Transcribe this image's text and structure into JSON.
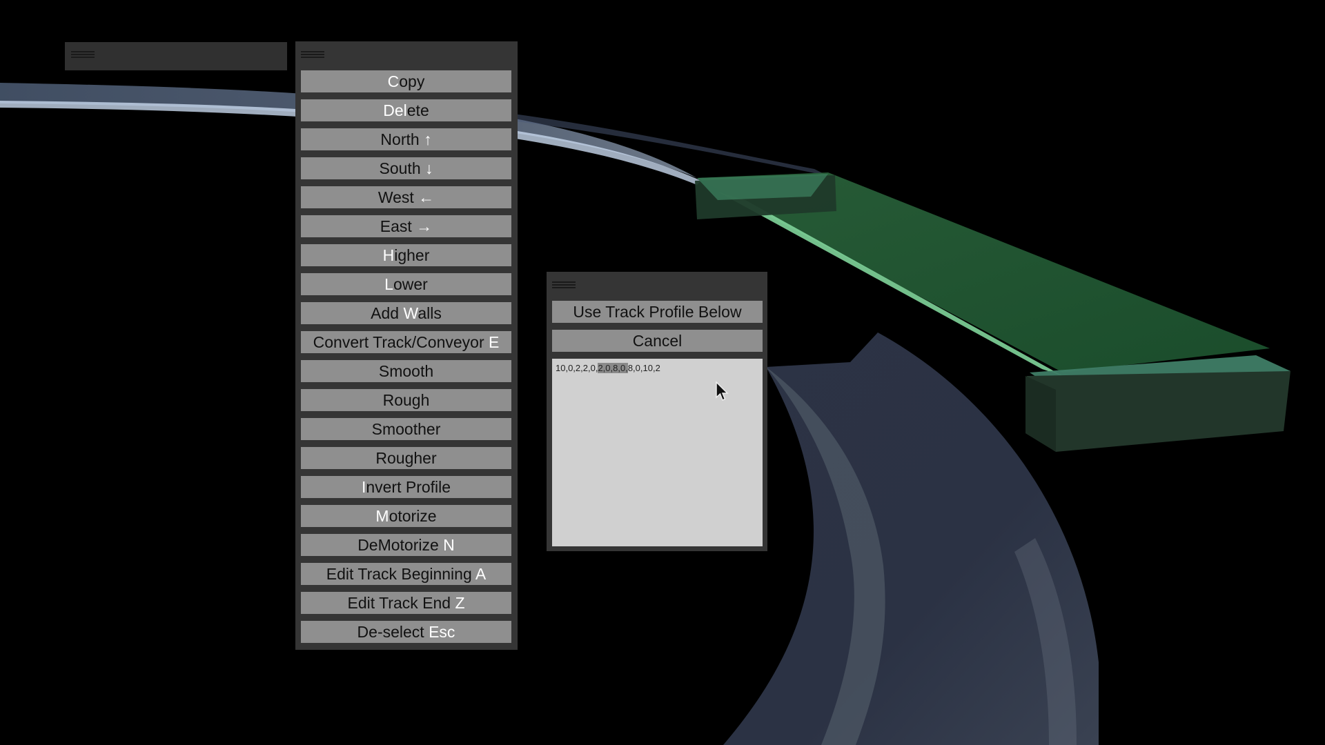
{
  "menu": {
    "items": [
      {
        "id": "copy",
        "pre": "",
        "hk": "C",
        "post": "opy"
      },
      {
        "id": "delete",
        "pre": "",
        "hk": "Del",
        "post": "ete"
      },
      {
        "id": "north",
        "pre": "North ",
        "hk": "↑",
        "post": ""
      },
      {
        "id": "south",
        "pre": "South ",
        "hk": "↓",
        "post": ""
      },
      {
        "id": "west",
        "pre": "West ",
        "hk": "←",
        "post": ""
      },
      {
        "id": "east",
        "pre": "East ",
        "hk": "→",
        "post": ""
      },
      {
        "id": "higher",
        "pre": "",
        "hk": "H",
        "post": "igher"
      },
      {
        "id": "lower",
        "pre": "",
        "hk": "L",
        "post": "ower"
      },
      {
        "id": "add-walls",
        "pre": "Add ",
        "hk": "W",
        "post": "alls"
      },
      {
        "id": "convert-track-conveyor",
        "pre": "Convert Track/Conveyor ",
        "hk": "E",
        "post": ""
      },
      {
        "id": "smooth",
        "pre": "Smooth",
        "hk": "",
        "post": ""
      },
      {
        "id": "rough",
        "pre": "Rough",
        "hk": "",
        "post": ""
      },
      {
        "id": "smoother",
        "pre": "Smoother",
        "hk": "",
        "post": ""
      },
      {
        "id": "rougher",
        "pre": "Rougher",
        "hk": "",
        "post": ""
      },
      {
        "id": "invert-profile",
        "pre": "",
        "hk": "I",
        "post": "nvert Profile"
      },
      {
        "id": "motorize",
        "pre": "",
        "hk": "M",
        "post": "otorize"
      },
      {
        "id": "demotorize",
        "pre": "DeMotorize ",
        "hk": "N",
        "post": ""
      },
      {
        "id": "edit-track-beginning",
        "pre": "Edit Track Beginning ",
        "hk": "A",
        "post": ""
      },
      {
        "id": "edit-track-end",
        "pre": "Edit Track End ",
        "hk": "Z",
        "post": ""
      },
      {
        "id": "deselect",
        "pre": "De-select ",
        "hk": "Esc",
        "post": ""
      }
    ]
  },
  "profile_dialog": {
    "use_label": "Use Track Profile Below",
    "cancel_label": "Cancel",
    "profile_before": "10,0,2,2,0,",
    "profile_selected": "2,0,8,0,",
    "profile_after": "8,0,10,2"
  },
  "colors": {
    "button_bg": "#8f8f8f",
    "hotkey_text": "#ffffff",
    "panel_bg": "#353535",
    "textarea_bg": "#d0d0d0"
  }
}
